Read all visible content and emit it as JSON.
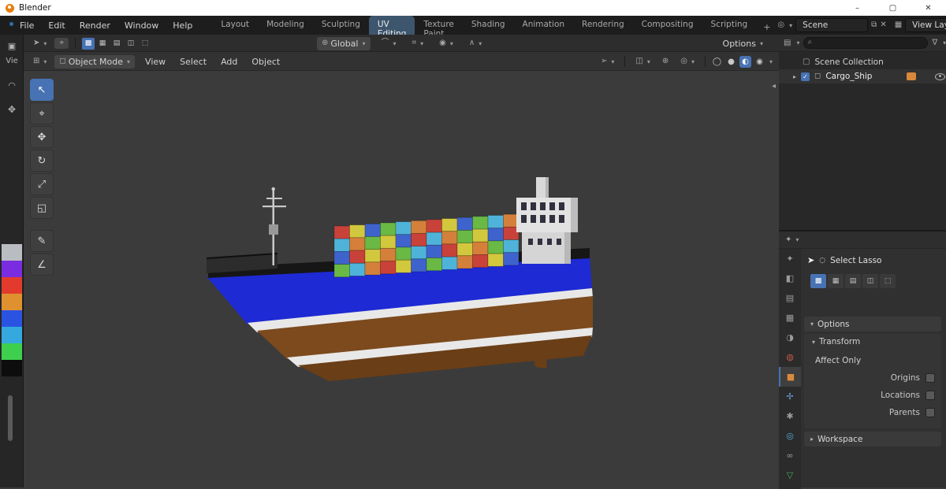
{
  "window": {
    "title": "Blender",
    "controls": [
      "minimize",
      "maximize",
      "close"
    ]
  },
  "menubar": {
    "menus": [
      "File",
      "Edit",
      "Render",
      "Window",
      "Help"
    ],
    "tabs": [
      "Layout",
      "Modeling",
      "Sculpting",
      "UV Editing",
      "Texture Paint",
      "Shading",
      "Animation",
      "Rendering",
      "Compositing",
      "Scripting"
    ],
    "active_tab": "UV Editing",
    "add_tab_label": "+",
    "scene_selector": "Scene",
    "view_layer_selector": "View Layer"
  },
  "topbar": {
    "orientation": "Global",
    "options_label": "Options"
  },
  "viewport_header": {
    "mode": "Object Mode",
    "menus": [
      "View",
      "Select",
      "Add",
      "Object"
    ]
  },
  "left_strip": {
    "header_label": "Vie",
    "palette": [
      "#b9bdc2",
      "#7a2ce0",
      "#e23b2e",
      "#e0912f",
      "#2b53e2",
      "#35a8e0",
      "#3ecf4e",
      "#0d0d0d"
    ]
  },
  "left_toolbar": [
    "select",
    "cursor",
    "move",
    "rotate",
    "scale",
    "transform",
    "annotate",
    "measure"
  ],
  "outliner": {
    "collection_label": "Scene Collection",
    "object_label": "Cargo_Ship"
  },
  "tool_panel": {
    "tool_name": "Select Lasso",
    "mode_icons": [
      "mode-new",
      "mode-extend",
      "mode-subtract",
      "mode-invert",
      "mode-intersect"
    ],
    "options_label": "Options",
    "transform_label": "Transform",
    "affect_only_label": "Affect Only",
    "toggles": [
      "Origins",
      "Locations",
      "Parents"
    ],
    "workspace_label": "Workspace"
  },
  "properties_tabs": [
    "tool",
    "render",
    "output",
    "view-layer",
    "scene",
    "world",
    "object",
    "modifiers",
    "particles",
    "physics",
    "constraints",
    "data"
  ],
  "ship": {
    "name": "Cargo_Ship",
    "hull_blue": "#1e2ad4",
    "hull_brown": "#7c4a1d",
    "hull_brown_dark": "#6a3e16",
    "stripe_white": "#e8e8e8",
    "deck_dark": "#161616",
    "bow_deck": "#2c2c2c",
    "superstructure": "#e2e2e2",
    "superstructure_shade": "#bdbdbd",
    "window_color": "#30303f",
    "mast_color": "#c8c8c8",
    "container_colors": [
      "#c8423a",
      "#d4803a",
      "#d2c83e",
      "#69b944",
      "#3f63cc",
      "#4fb3d9"
    ]
  }
}
